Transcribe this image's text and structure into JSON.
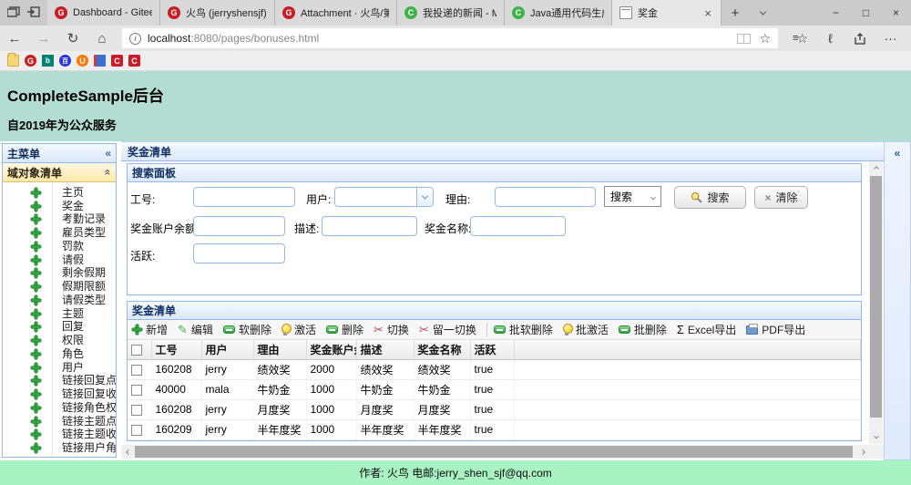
{
  "colors": {
    "page_header_bg": "#b3dcd3",
    "footer_bg": "#a9f2c4",
    "panel_border": "#95b8e7",
    "panel_title_text": "#0e2d5f",
    "accordion_selected_bg": "#ffe9a9",
    "gitee_red": "#c71d23",
    "menu_icon_green": "#2ea63d",
    "active_tab_bg": "#e7e7e7"
  },
  "browser": {
    "tabbar": {
      "tabs": [
        {
          "label": "Dashboard - Gitee",
          "icon": "gitee"
        },
        {
          "label": "火鸟 (jerryshensjf) - Git",
          "icon": "gitee"
        },
        {
          "label": "Attachment · 火鸟/第三",
          "icon": "gitee"
        },
        {
          "label": "我投递的新闻 - MS&A(",
          "icon": "green-c"
        },
        {
          "label": "Java通用代码生成器光",
          "icon": "green-c"
        },
        {
          "label": "奖金",
          "icon": "page",
          "active": true
        }
      ],
      "new_tab": "+",
      "close_tab": "×"
    },
    "window_controls": {
      "minimize": "−",
      "maximize": "□",
      "close": "×"
    },
    "address": {
      "back": "←",
      "forward": "→",
      "refresh": "↻",
      "home": "⌂",
      "info": "i",
      "url_host": "localhost",
      "url_path": ":8080/pages/bonuses.html",
      "star": "☆",
      "hub_lines": "≡",
      "hub_star": "☆",
      "pen": "ℓ",
      "more": "···"
    },
    "bookmarks": [
      {
        "name": "folder",
        "glyph": ""
      },
      {
        "name": "gitee",
        "glyph": "G"
      },
      {
        "name": "bing",
        "glyph": "b"
      },
      {
        "name": "baidu",
        "glyph": "百"
      },
      {
        "name": "uc",
        "glyph": "U"
      },
      {
        "name": "notebook",
        "glyph": ""
      },
      {
        "name": "csdn-1",
        "glyph": "C"
      },
      {
        "name": "csdn-2",
        "glyph": "C"
      }
    ],
    "favicon_glyphs": {
      "gitee": "G",
      "green_c": "C"
    }
  },
  "page_header": {
    "title": "CompleteSample后台",
    "subtitle": "自2019年为公众服务"
  },
  "sidebar": {
    "panel_title": "主菜单",
    "collapse_icon": "«",
    "accordion_title": "域对象清单",
    "accordion_collapse_icon": "«",
    "items": [
      "主页",
      "奖金",
      "考勤记录",
      "雇员类型",
      "罚款",
      "请假",
      "剩余假期",
      "假期限额",
      "请假类型",
      "主题",
      "回复",
      "权限",
      "角色",
      "用户",
      "链接回复点赞用户",
      "链接回复收藏用户",
      "链接角色权限",
      "链接主题点赞用户",
      "链接主题收藏用户",
      "链接用户角色"
    ]
  },
  "main": {
    "panel_title": "奖金清单",
    "east_collapse_icon": "«",
    "search_panel": {
      "title": "搜索面板",
      "labels": {
        "employee_no": "工号:",
        "user": "用户:",
        "reason": "理由:",
        "balance": "奖金账户余额:",
        "description": "描述:",
        "bonus_name": "奖金名称:",
        "active": "活跃:"
      },
      "values": {
        "employee_no": "",
        "user": "",
        "reason": "",
        "balance": "",
        "description": "",
        "bonus_name": "",
        "active": ""
      },
      "search_type_value": "搜索",
      "search_button": "搜索",
      "clear_button": "清除",
      "clear_icon": "×"
    },
    "grid_panel": {
      "title": "奖金清单",
      "toolbar": [
        {
          "label": "新增",
          "icon": "add"
        },
        {
          "label": "编辑",
          "icon": "pencil"
        },
        {
          "label": "软删除",
          "icon": "pill"
        },
        {
          "label": "激活",
          "icon": "bulb"
        },
        {
          "label": "删除",
          "icon": "pill"
        },
        {
          "label": "切换",
          "icon": "scissors"
        },
        {
          "label": "留一切换",
          "icon": "scissors"
        },
        {
          "label": "批软删除",
          "icon": "pill"
        },
        {
          "label": "批激活",
          "icon": "bulb"
        },
        {
          "label": "批删除",
          "icon": "pill"
        },
        {
          "label": "Excel导出",
          "icon": "sigma"
        },
        {
          "label": "PDF导出",
          "icon": "print"
        }
      ],
      "icon_glyphs": {
        "sigma": "Σ",
        "pencil": "✎",
        "scissors": "✂"
      },
      "columns": [
        "工号",
        "用户",
        "理由",
        "奖金账户余额",
        "描述",
        "奖金名称",
        "活跃"
      ],
      "rows": [
        [
          "160208",
          "jerry",
          "绩效奖",
          "2000",
          "绩效奖",
          "绩效奖",
          "true"
        ],
        [
          "40000",
          "mala",
          "牛奶金",
          "1000",
          "牛奶金",
          "牛奶金",
          "true"
        ],
        [
          "160208",
          "jerry",
          "月度奖",
          "1000",
          "月度奖",
          "月度奖",
          "true"
        ],
        [
          "160209",
          "jerry",
          "半年度奖",
          "1000",
          "半年度奖",
          "半年度奖",
          "true"
        ]
      ]
    }
  },
  "footer": {
    "text": "作者: 火鸟 电邮:jerry_shen_sjf@qq.com"
  }
}
